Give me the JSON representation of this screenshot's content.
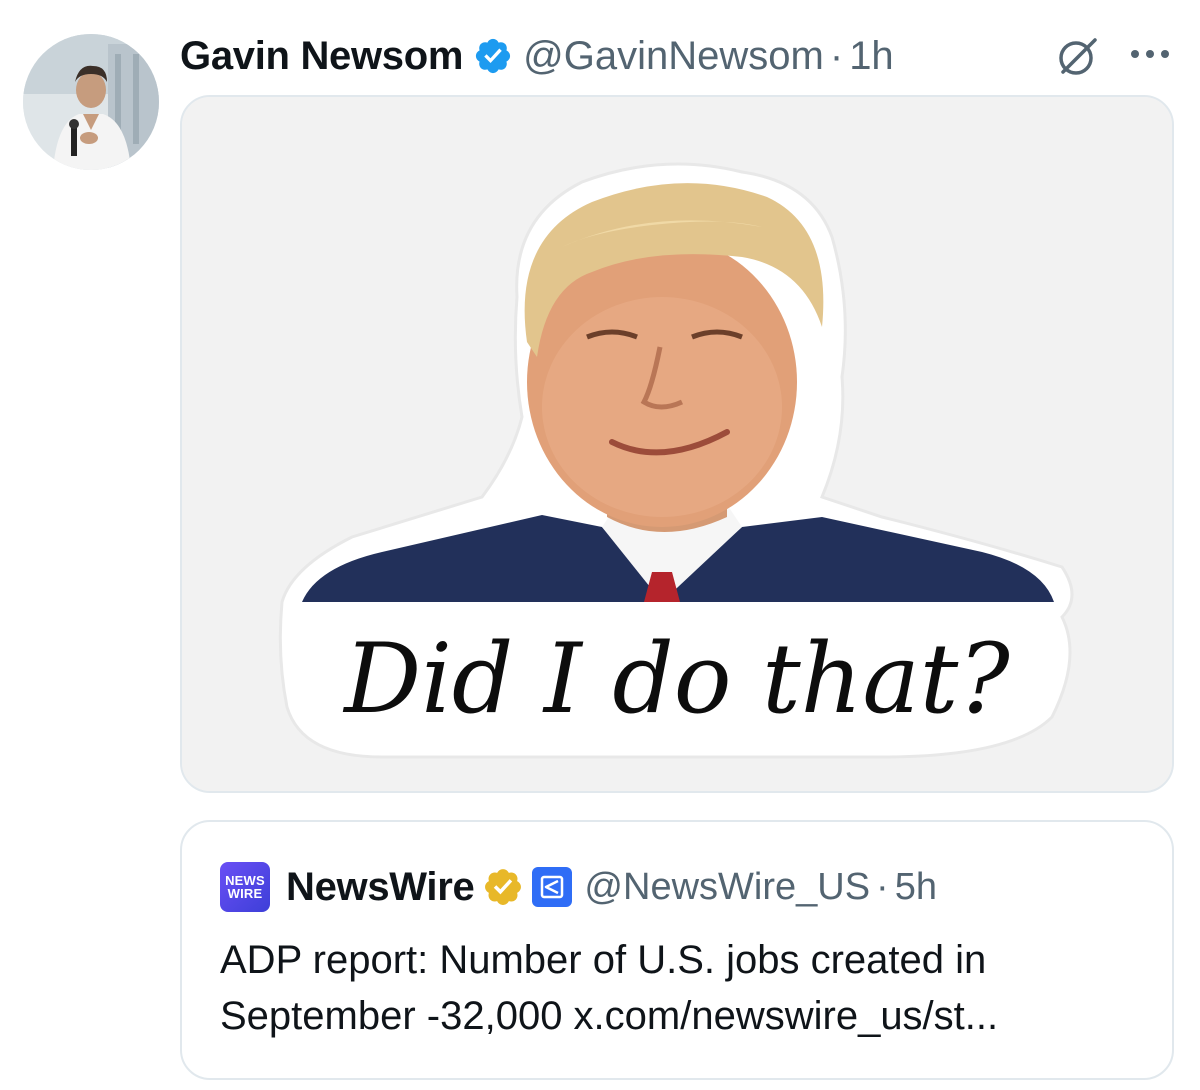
{
  "tweet": {
    "author": {
      "display_name": "Gavin Newsom",
      "handle": "@GavinNewsom",
      "verified": true,
      "verified_color": "#1d9bf0"
    },
    "dot": "·",
    "time": "1h",
    "media": {
      "caption": "Did I do that?"
    },
    "icons": {
      "grok": "grok-icon",
      "more": "more-icon"
    }
  },
  "quoted_tweet": {
    "avatar_text_line1": "NEWS",
    "avatar_text_line2": "WIRE",
    "display_name": "NewsWire",
    "verified_color": "#e8b829",
    "affiliate_color": "#2f6df6",
    "handle": "@NewsWire_US",
    "dot": "·",
    "time": "5h",
    "text_line1": "ADP report: Number of U.S. jobs created in",
    "text_line2": "September -32,000 x.com/newswire_us/st..."
  }
}
